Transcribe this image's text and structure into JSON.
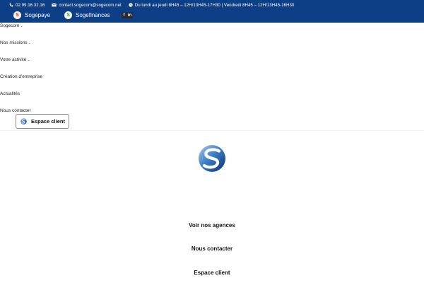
{
  "topbar": {
    "phone": "02.99.16.32.16",
    "email": "contact.sogecom@sogecom.net",
    "hours": "Du lundi au jeudi 8H45 – 12H/13H45-17H30 | Vendredi 8H45 – 12H/13H45-16H30",
    "brands": [
      {
        "label": "Sogepaye",
        "logo_letter": "S",
        "color": "#d8232a"
      },
      {
        "label": "Sogefinances",
        "logo_letter": "S",
        "color": "#2e9a4b"
      }
    ],
    "social": [
      "f",
      "in"
    ],
    "background": "#0d3f86"
  },
  "nav": {
    "items": [
      {
        "label": "Sogecom",
        "has_dropdown": true
      },
      {
        "label": "Nos missions",
        "has_dropdown": true
      },
      {
        "label": "Votre activité",
        "has_dropdown": true
      },
      {
        "label": "Création d'entreprise",
        "has_dropdown": false
      },
      {
        "label": "Actualités",
        "has_dropdown": false
      },
      {
        "label": "Nous contacter",
        "has_dropdown": false
      }
    ]
  },
  "espace_button": {
    "label": "Espace client"
  },
  "footer_links": {
    "agences": "Voir nos agences",
    "contact": "Nous contacter",
    "espace": "Espace client"
  }
}
